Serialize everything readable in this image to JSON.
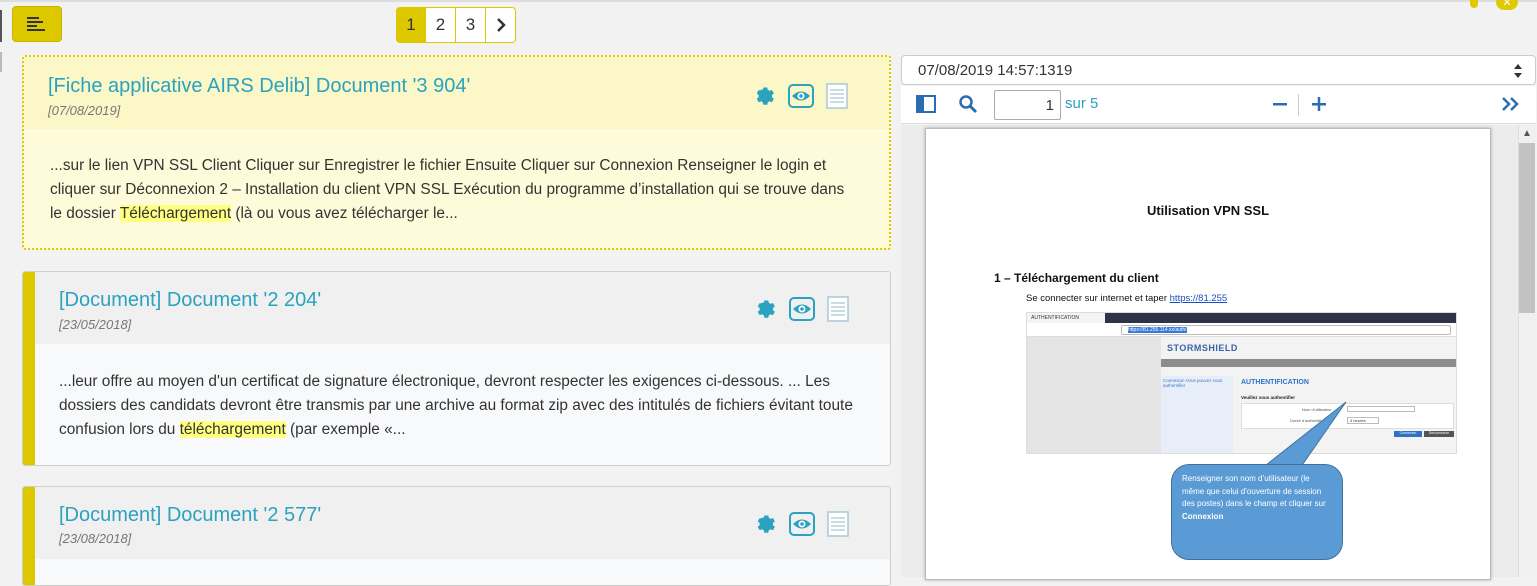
{
  "header": {
    "menu_button_icon": "align-left-icon",
    "pagination": {
      "pages": [
        "1",
        "2",
        "3"
      ],
      "active": "1",
      "next_icon": "chevron-right-icon"
    }
  },
  "results": [
    {
      "title": "[Fiche applicative AIRS Delib] Document '3 904'",
      "date": "[07/08/2019]",
      "snippet_before": "...sur le lien VPN SSL Client Cliquer sur Enregistrer le fichier Ensuite Cliquer sur Connexion Renseigner le login et cliquer sur Déconnexion 2 – Installation du client VPN SSL Exécution du programme d’installation qui se trouve dans le dossier ",
      "snippet_highlight": "Téléchargement",
      "snippet_after": " (là ou vous avez télécharger le..."
    },
    {
      "title": "[Document] Document '2 204'",
      "date": "[23/05/2018]",
      "snippet_before": "...leur offre au moyen d'un certificat de signature électronique, devront respecter les exigences ci-dessous. ... Les dossiers des candidats devront être transmis par une archive au format zip avec des intitulés de fichiers évitant toute confusion lors du ",
      "snippet_highlight": "téléchargement",
      "snippet_after": " (par exemple «..."
    },
    {
      "title": "[Document] Document '2 577'",
      "date": "[23/08/2018]",
      "snippet_before": "",
      "snippet_highlight": "",
      "snippet_after": ""
    }
  ],
  "viewer": {
    "version": "07/08/2019 14:57:1319",
    "page_value": "1",
    "page_total_label": "sur 5",
    "document": {
      "title": "Utilisation VPN SSL",
      "heading": "1 – Téléchargement du client",
      "intro": "Se connecter sur internet et taper ",
      "link": "https://81.255",
      "screenshot": {
        "tab": "AUTHENTIFICATION",
        "url_highlight": "https://81.255.114.xx",
        "url_rest": "/auth/",
        "brand": "STORMSHIELD",
        "left_text": "Connexion Vous pouvez vous authentifier",
        "auth_heading": "AUTHENTIFICATION",
        "auth_prompt": "Veuillez vous authentifier",
        "login_label": "Nom d'utilisateur",
        "duration_label": "Durée d'authentification",
        "duration_value": "4 heures",
        "btn_login": "Connexion",
        "btn_logout": "Déconnexion"
      },
      "callout_text": "Renseigner son nom d’utilisateur (le même que celui d’ouverture de session des postes) dans le champ et cliquer sur ",
      "callout_bold": "Connexion"
    }
  },
  "colors": {
    "accent": "#ddc800",
    "link": "#2aa2c0",
    "highlight": "#ffff80"
  }
}
